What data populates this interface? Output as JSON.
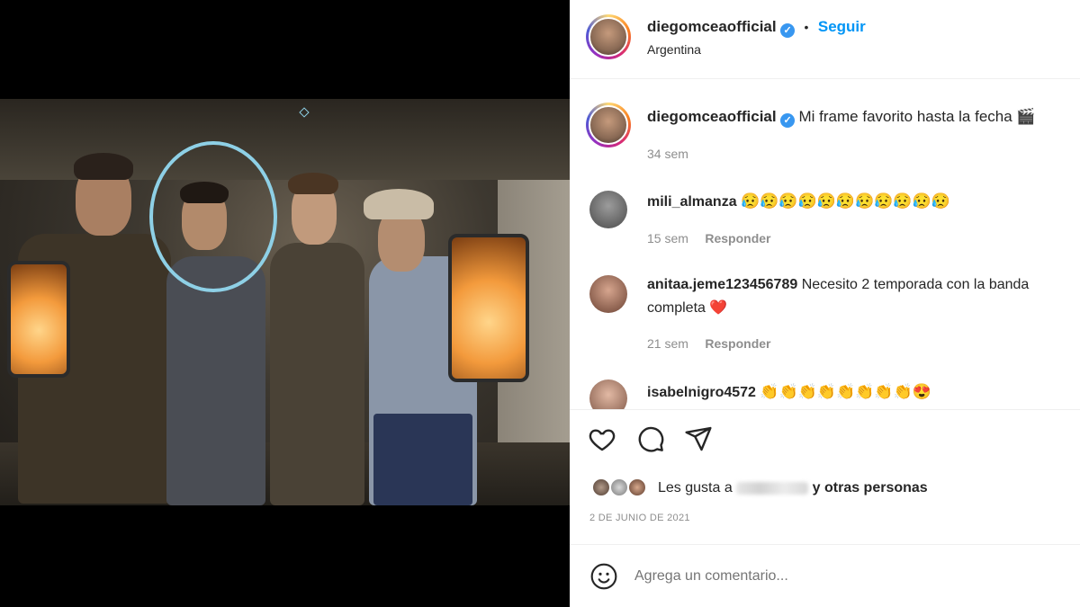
{
  "post": {
    "author": "diegomceaofficial",
    "location": "Argentina",
    "follow_label": "Seguir",
    "separator": "•"
  },
  "caption": {
    "author": "diegomceaofficial",
    "text": "Mi frame favorito hasta la fecha 🎬",
    "time": "34 sem"
  },
  "comments": [
    {
      "user": "mili_almanza",
      "text": "😥😥😥😥😥😥😥😥😥😥😥",
      "time": "15 sem",
      "reply": "Responder"
    },
    {
      "user": "anitaa.jeme123456789",
      "text": "Necesito 2 temporada con la banda",
      "text2": "completa ❤️",
      "time": "21 sem",
      "reply": "Responder"
    },
    {
      "user": "isabelnigro4572",
      "text": "👏👏👏👏👏👏👏👏😍"
    }
  ],
  "likes": {
    "prefix": "Les gusta a",
    "suffix": "y otras personas"
  },
  "date": "2 DE JUNIO DE 2021",
  "add_comment": {
    "placeholder": "Agrega un comentario..."
  },
  "icons": {
    "like": "heart-icon",
    "comment": "comment-icon",
    "share": "paper-plane-icon",
    "emoji": "smiley-icon",
    "verified": "verified-badge-icon"
  },
  "colors": {
    "accent": "#0095f6",
    "verified": "#3897f0",
    "highlight_circle": "#8ed0e6",
    "heart": "#ed4956"
  }
}
